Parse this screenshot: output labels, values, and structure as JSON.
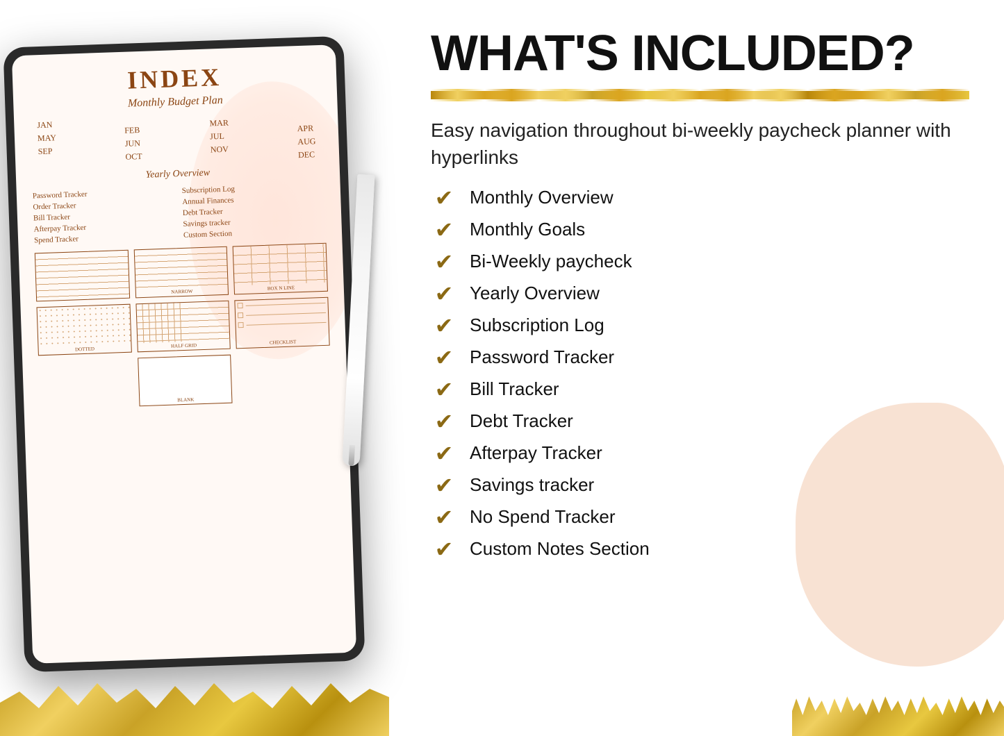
{
  "heading": "WHAT'S INCLUDED?",
  "navigation_text": "Easy navigation throughout bi-weekly paycheck planner with hyperlinks",
  "checklist_items": [
    "Monthly Overview",
    "Monthly Goals",
    "Bi-Weekly paycheck",
    "Yearly Overview",
    "Subscription Log",
    "Password Tracker",
    "Bill Tracker",
    "Debt Tracker",
    "Afterpay Tracker",
    "Savings tracker",
    "No Spend Tracker",
    "Custom Notes Section"
  ],
  "tablet": {
    "index_title": "INDEX",
    "subtitle": "Monthly Budget Plan",
    "months": [
      "JAN",
      "FEB",
      "MAR",
      "APR",
      "MAY",
      "JUN",
      "JUL",
      "AUG",
      "SEP",
      "OCT",
      "NOV",
      "DEC"
    ],
    "yearly_label": "Yearly Overview",
    "trackers_left": [
      "Password Tracker",
      "Order Tracker",
      "Bill Tracker",
      "Afterpay Tracker",
      "Spend Tracker"
    ],
    "trackers_right": [
      "Subscription Log",
      "Annual Finances",
      "Debt Tracker",
      "Savings tracker",
      "Custom Section"
    ],
    "templates": [
      {
        "label": "",
        "pattern": "narrow"
      },
      {
        "label": "NARROW",
        "pattern": "narrow"
      },
      {
        "label": "BOX N LINE",
        "pattern": "boxnline"
      },
      {
        "label": "DOTTED",
        "pattern": "dotted"
      },
      {
        "label": "HALF GRID",
        "pattern": "halfgrid"
      },
      {
        "label": "CHECKLIST",
        "pattern": "checklist"
      },
      {
        "label": "BLANK",
        "pattern": "blank"
      }
    ]
  }
}
